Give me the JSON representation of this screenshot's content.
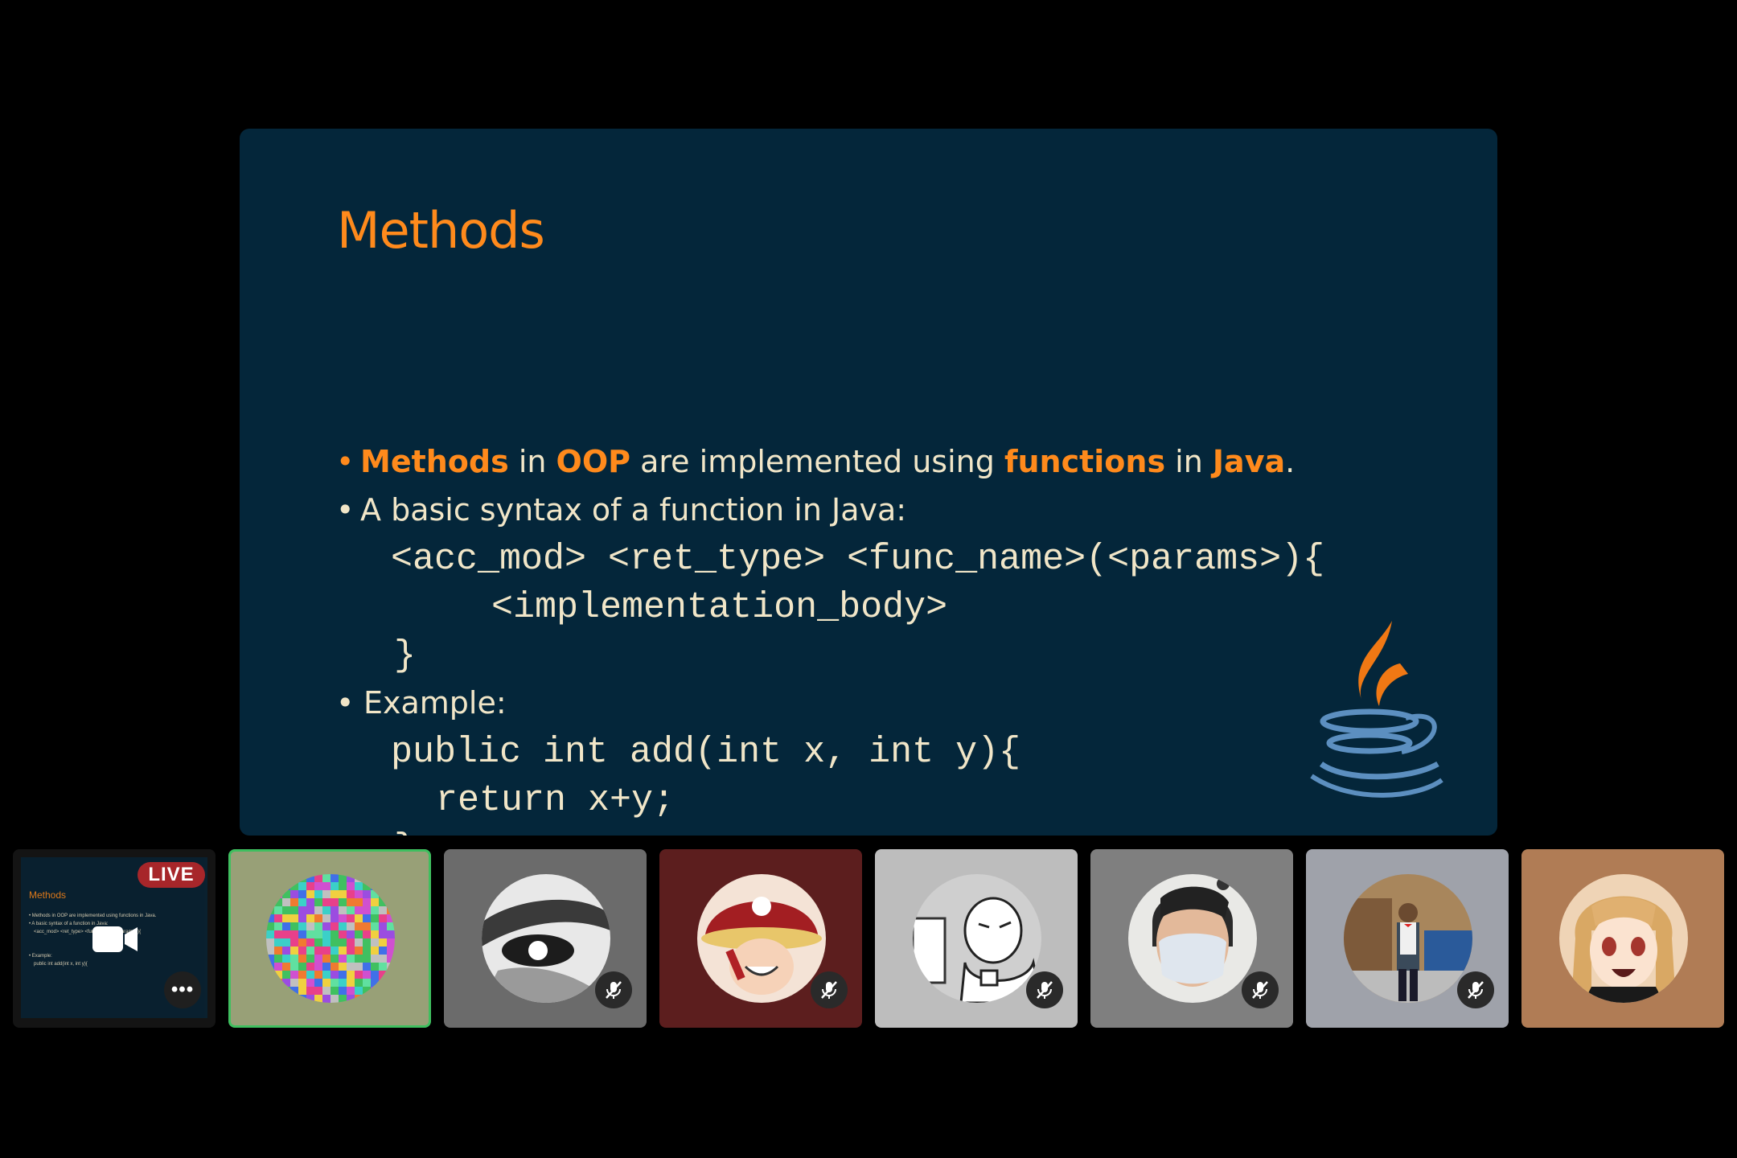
{
  "slide": {
    "title": "Methods",
    "bullet1": {
      "w1": "Methods",
      "t1": " in ",
      "w2": "OOP",
      "t2": " are implemented using ",
      "w3": "functions",
      "t3": " in ",
      "w4": "Java",
      "t4": "."
    },
    "bullet2": "A basic syntax of a function in Java:",
    "syntax": [
      "<acc_mod> <ret_type> <func_name>(<params>){",
      "   <implementation_body>",
      "}"
    ],
    "bullet3": "Example:",
    "example": [
      "public int add(int x, int y){",
      "  return x+y;",
      "}"
    ],
    "bullet_symbol": "•"
  },
  "participants": {
    "live_label": "LIVE",
    "more_label": "•••",
    "mini_slide": {
      "title": "Methods",
      "line1": "• Methods in OOP are implemented using functions in Java.",
      "line2": "• A basic syntax of a function in Java:",
      "line3": "<acc_mod> <ret_type> <func_name>(<params>){",
      "line4": "• Example:",
      "line5": "public int add(int x, int y){"
    },
    "tile_colors": [
      "#1a1a1a",
      "#98a077",
      "#6b6b6b",
      "#5c1e1e",
      "#bdbdbd",
      "#7f7f7f",
      "#9fa2aa",
      "#b07c55"
    ],
    "active_border": "#3fbf5f"
  },
  "colors": {
    "slide_bg": "#04263a",
    "accent": "#ff8a1c",
    "text": "#f1e6c8"
  }
}
